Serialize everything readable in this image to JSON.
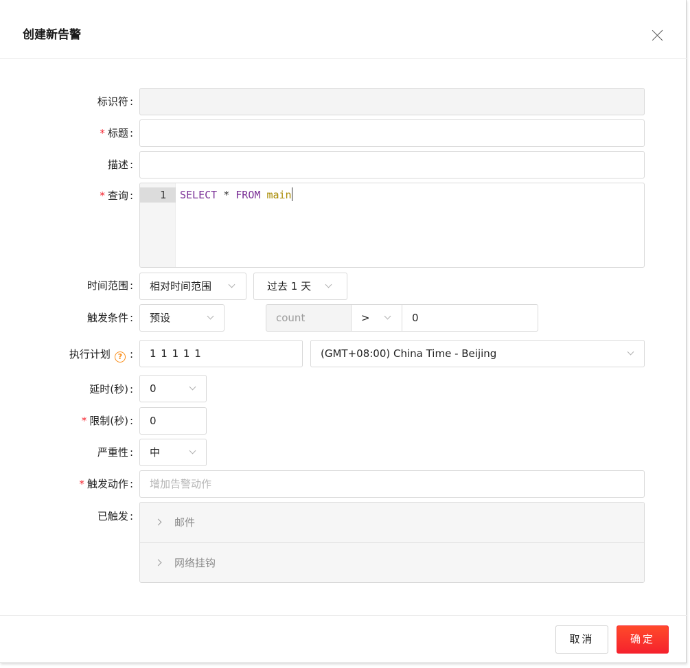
{
  "dialog": {
    "title": "创建新告警"
  },
  "form": {
    "identifier": {
      "label": "标识符",
      "value": ""
    },
    "title": {
      "label": "标题",
      "value": ""
    },
    "description": {
      "label": "描述",
      "value": ""
    },
    "query": {
      "label": "查询",
      "line_number": "1",
      "keyword_select": "SELECT",
      "star": "*",
      "keyword_from": "FROM",
      "table": "main"
    },
    "time_range": {
      "label": "时间范围",
      "mode": "相对时间范围",
      "value": "过去 1 天"
    },
    "trigger_condition": {
      "label": "触发条件",
      "preset": "预设",
      "field": "count",
      "operator": ">",
      "threshold": "0"
    },
    "schedule": {
      "label": "执行计划",
      "help_glyph": "?",
      "cron": "1 1 1 1 1",
      "timezone": "(GMT+08:00) China Time - Beijing"
    },
    "delay": {
      "label": "延时(秒)",
      "value": "0"
    },
    "limit": {
      "label": "限制(秒)",
      "value": "0"
    },
    "severity": {
      "label": "严重性",
      "value": "中"
    },
    "actions": {
      "label": "触发动作",
      "placeholder": "增加告警动作"
    },
    "triggered": {
      "label": "已触发",
      "items": [
        "邮件",
        "网络挂钩"
      ]
    }
  },
  "colon": ":",
  "required_mark": "*",
  "footer": {
    "cancel_label": "取消",
    "ok_label": "确定"
  },
  "colors": {
    "primary": "#f5222d",
    "help": "#fa8c16",
    "keyword": "#7a2f96",
    "identifier": "#a88a00"
  }
}
